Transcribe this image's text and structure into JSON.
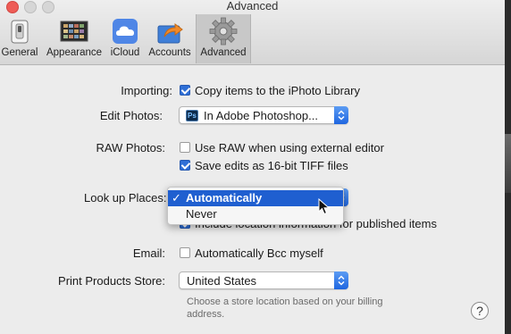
{
  "window": {
    "title": "Advanced"
  },
  "toolbar": {
    "items": [
      {
        "label": "General",
        "icon": "general-switch-icon"
      },
      {
        "label": "Appearance",
        "icon": "appearance-icon"
      },
      {
        "label": "iCloud",
        "icon": "icloud-icon"
      },
      {
        "label": "Accounts",
        "icon": "accounts-share-icon"
      },
      {
        "label": "Advanced",
        "icon": "gear-icon",
        "active": true
      }
    ]
  },
  "importing": {
    "label": "Importing:",
    "option": "Copy items to the iPhoto Library",
    "checked": true
  },
  "edit_photos": {
    "label": "Edit Photos:",
    "badge": "Ps",
    "value": "In Adobe Photoshop..."
  },
  "raw_photos": {
    "label": "RAW Photos:",
    "use_raw": {
      "text": "Use RAW when using external editor",
      "checked": false
    },
    "save_tiff": {
      "text": "Save edits as 16-bit TIFF files",
      "checked": true
    }
  },
  "lookup_places": {
    "label": "Look up Places:",
    "menu": {
      "selected": "Automatically",
      "options": [
        "Automatically",
        "Never"
      ],
      "check": "✓"
    },
    "hidden_option_text": "Include location information for published items"
  },
  "email": {
    "label": "Email:",
    "option": "Automatically Bcc myself",
    "checked": false
  },
  "print_store": {
    "label": "Print Products Store:",
    "value": "United States",
    "note": "Choose a store location based on your billing address."
  },
  "help": {
    "glyph": "?"
  },
  "colors": {
    "accent": "#1f66e0",
    "selection": "#1f5fd0",
    "close": "#ee5c56"
  }
}
